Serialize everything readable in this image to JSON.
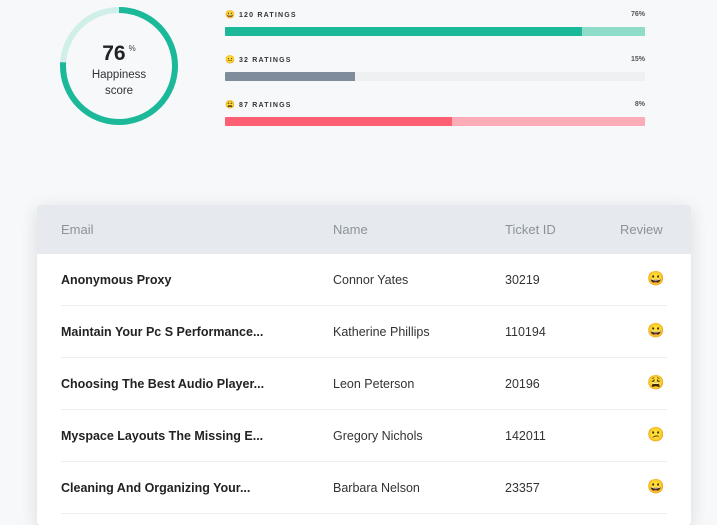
{
  "happiness": {
    "score": 76,
    "percent_sign": "%",
    "label_line1": "Happiness",
    "label_line2": "score",
    "color": "#1bb99a",
    "track": "#d1efe9"
  },
  "ratings": [
    {
      "emoji": "😀",
      "count_label": "120 RATINGS",
      "percent_label": "76%",
      "fill": 0.85,
      "color": "#1bb99a",
      "rest": "#8fdcc9"
    },
    {
      "emoji": "😐",
      "count_label": "32 RATINGS",
      "percent_label": "15%",
      "fill": 0.31,
      "color": "#7f8c9b",
      "rest": "#eef0f2"
    },
    {
      "emoji": "😩",
      "count_label": "87 RATINGS",
      "percent_label": "8%",
      "fill": 0.54,
      "color": "#ff5f73",
      "rest": "#fbacb6"
    }
  ],
  "table": {
    "headers": {
      "email": "Email",
      "name": "Name",
      "ticket": "Ticket ID",
      "review": "Review"
    },
    "rows": [
      {
        "email": "Anonymous Proxy",
        "name": "Connor Yates",
        "ticket": "30219",
        "review": "😀"
      },
      {
        "email": "Maintain Your Pc S Performance...",
        "name": "Katherine Phillips",
        "ticket": "110194",
        "review": "😀"
      },
      {
        "email": "Choosing The Best Audio Player...",
        "name": "Leon Peterson",
        "ticket": "20196",
        "review": "😩"
      },
      {
        "email": "Myspace Layouts The Missing E...",
        "name": "Gregory Nichols",
        "ticket": "142011",
        "review": "😕"
      },
      {
        "email": "Cleaning And Organizing Your...",
        "name": "Barbara Nelson",
        "ticket": "23357",
        "review": "😀"
      }
    ]
  }
}
